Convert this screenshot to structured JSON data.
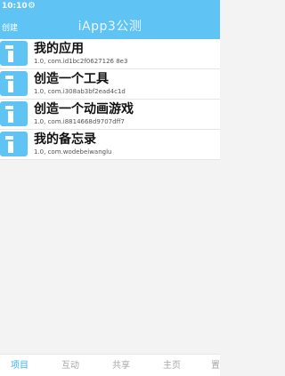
{
  "status_bar": {
    "time": "10:10",
    "icon": "gear-icon"
  },
  "header": {
    "create_label": "创建",
    "title": "iApp3公测"
  },
  "apps": [
    {
      "name": "我的应用",
      "package": "1.0, com.id1bc2f0627126 8e3"
    },
    {
      "name": "创造一个工具",
      "package": "1.0, com.i308ab3bf2ead4c1d"
    },
    {
      "name": "创造一个动画游戏",
      "package": "1.0, com.i8814668d9707dff7"
    },
    {
      "name": "我的备忘录",
      "package": "1.0, com.wodebeiwanglu"
    }
  ],
  "bottom_nav": {
    "tabs": [
      {
        "label": "项目"
      },
      {
        "label": "互动"
      },
      {
        "label": "共享"
      },
      {
        "label": "主页"
      },
      {
        "label": "置"
      }
    ]
  },
  "colors": {
    "accent": "#5fc4f3",
    "active_tab": "#3bb5ef",
    "inactive_tab": "#a8a8a8"
  }
}
